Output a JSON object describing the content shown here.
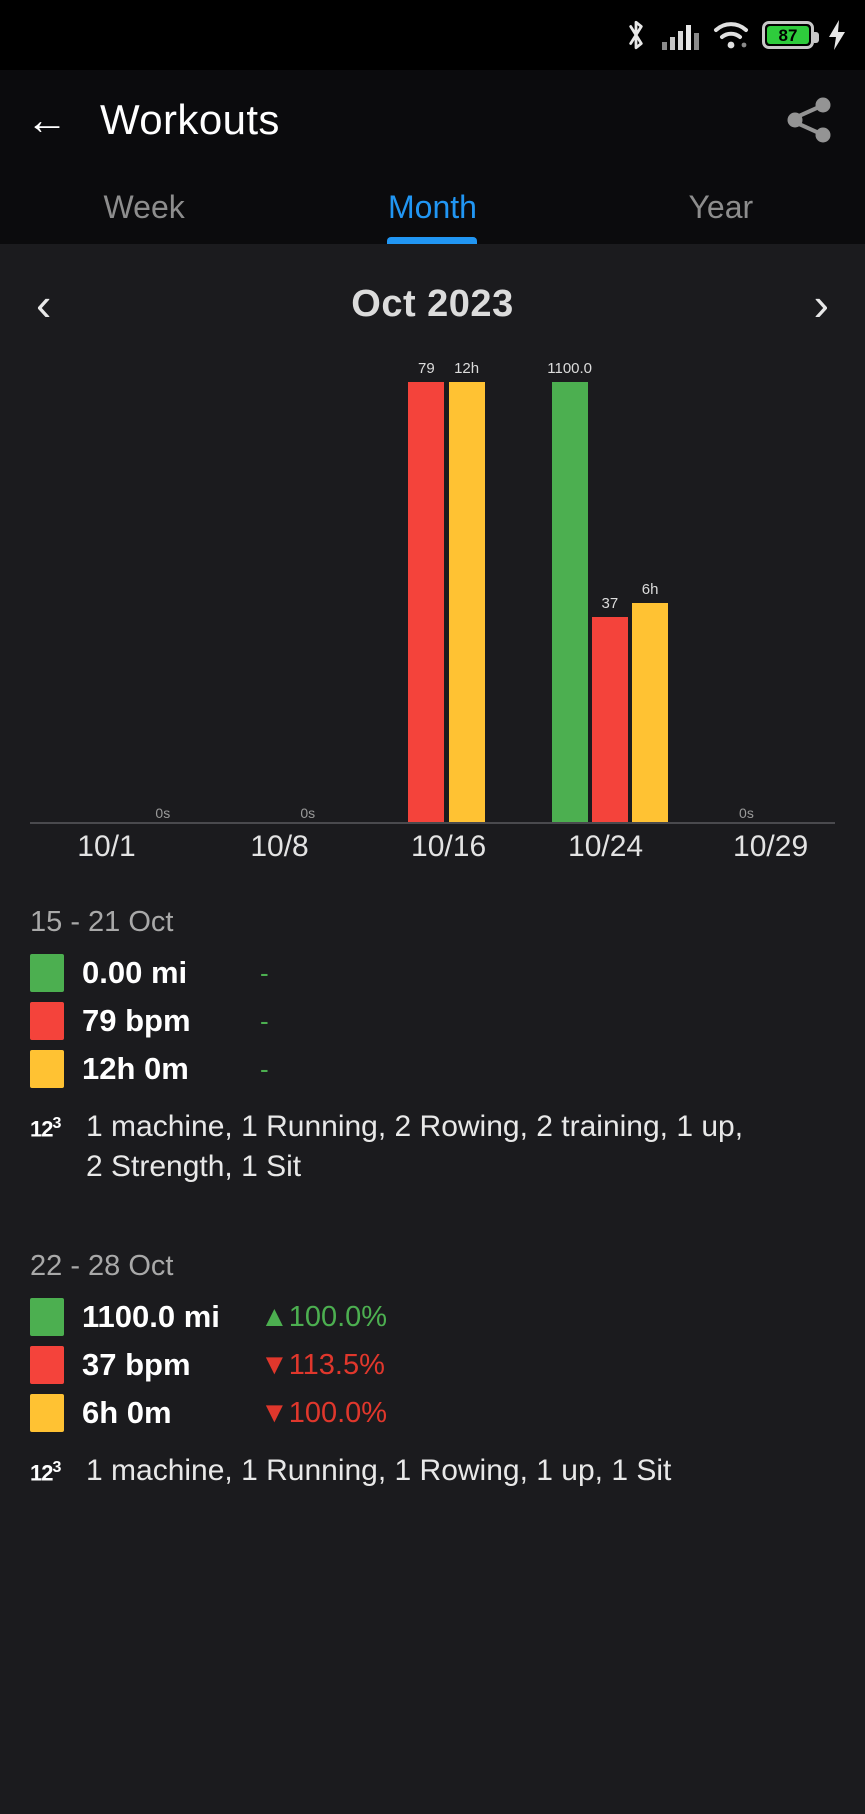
{
  "statusbar": {
    "battery_percent": "87",
    "icons": [
      "bluetooth-icon",
      "cellular-signal-icon",
      "wifi-icon",
      "battery-icon",
      "charging-bolt-icon"
    ]
  },
  "appbar": {
    "back_label": "←",
    "title": "Workouts",
    "share_icon": "share-icon"
  },
  "tabs": [
    {
      "label": "Week",
      "active": false
    },
    {
      "label": "Month",
      "active": true
    },
    {
      "label": "Year",
      "active": false
    }
  ],
  "monthnav": {
    "prev": "‹",
    "title": "Oct 2023",
    "next": "›"
  },
  "colors": {
    "distance": "#4caf50",
    "heartrate": "#f4433b",
    "duration": "#ffc233",
    "accent": "#2196f3",
    "up": "#4caf50",
    "down": "#e0372c"
  },
  "chart_data": {
    "type": "bar",
    "title": "Oct 2023",
    "xlabel": "",
    "ylabel": "",
    "grid": false,
    "legend_position": "below-chart",
    "categories": [
      "10/1",
      "10/8",
      "10/16",
      "10/24",
      "10/29"
    ],
    "tick_positions_pct": [
      9.5,
      31,
      52,
      71.5,
      92
    ],
    "series": [
      {
        "name": "Distance (mi)",
        "color": "#4caf50",
        "values": [
          0,
          0,
          0,
          1100.0,
          0
        ],
        "labels": [
          "",
          "",
          "",
          "1100.0",
          ""
        ]
      },
      {
        "name": "Heart rate (bpm)",
        "color": "#f4433b",
        "values": [
          0,
          0,
          79,
          37,
          0
        ],
        "labels": [
          "",
          "",
          "79",
          "37",
          ""
        ]
      },
      {
        "name": "Duration (h)",
        "color": "#ffc233",
        "values": [
          0,
          0,
          12,
          6,
          0
        ],
        "labels": [
          "",
          "",
          "12h",
          "6h",
          ""
        ]
      }
    ],
    "zero_labels": [
      {
        "text": "0s",
        "x_pct": 16.5
      },
      {
        "text": "0s",
        "x_pct": 34.5
      },
      {
        "text": "0s",
        "x_pct": 89.0
      }
    ],
    "bars": [
      {
        "series": "Heart rate (bpm)",
        "color": "#f4433b",
        "label": "79",
        "x_pct": 47.0,
        "height_pct": 100.0
      },
      {
        "series": "Duration (h)",
        "color": "#ffc233",
        "label": "12h",
        "x_pct": 52.0,
        "height_pct": 100.0
      },
      {
        "series": "Distance (mi)",
        "color": "#4caf50",
        "label": "1100.0",
        "x_pct": 64.8,
        "height_pct": 100.0
      },
      {
        "series": "Heart rate (bpm)",
        "color": "#f4433b",
        "label": "37",
        "x_pct": 69.8,
        "height_pct": 46.8
      },
      {
        "series": "Duration (h)",
        "color": "#ffc233",
        "label": "6h",
        "x_pct": 74.8,
        "height_pct": 50.0
      }
    ]
  },
  "summaries": [
    {
      "range": "15 - 21 Oct",
      "metrics": [
        {
          "color": "#4caf50",
          "value": "0.00 mi",
          "delta": "-",
          "dir": "none"
        },
        {
          "color": "#f4433b",
          "value": "79 bpm",
          "delta": "-",
          "dir": "none"
        },
        {
          "color": "#ffc233",
          "value": "12h 0m",
          "delta": "-",
          "dir": "none"
        }
      ],
      "activities": "1 machine, 1 Running, 2 Rowing, 2 training, 1 up, 2 Strength, 1 Sit"
    },
    {
      "range": "22 - 28 Oct",
      "metrics": [
        {
          "color": "#4caf50",
          "value": "1100.0 mi",
          "delta": "▲100.0%",
          "dir": "up"
        },
        {
          "color": "#f4433b",
          "value": "37 bpm",
          "delta": "▼113.5%",
          "dir": "down"
        },
        {
          "color": "#ffc233",
          "value": "6h 0m",
          "delta": "▼100.0%",
          "dir": "down"
        }
      ],
      "activities": "1 machine, 1 Running, 1 Rowing, 1 up, 1 Sit"
    }
  ]
}
